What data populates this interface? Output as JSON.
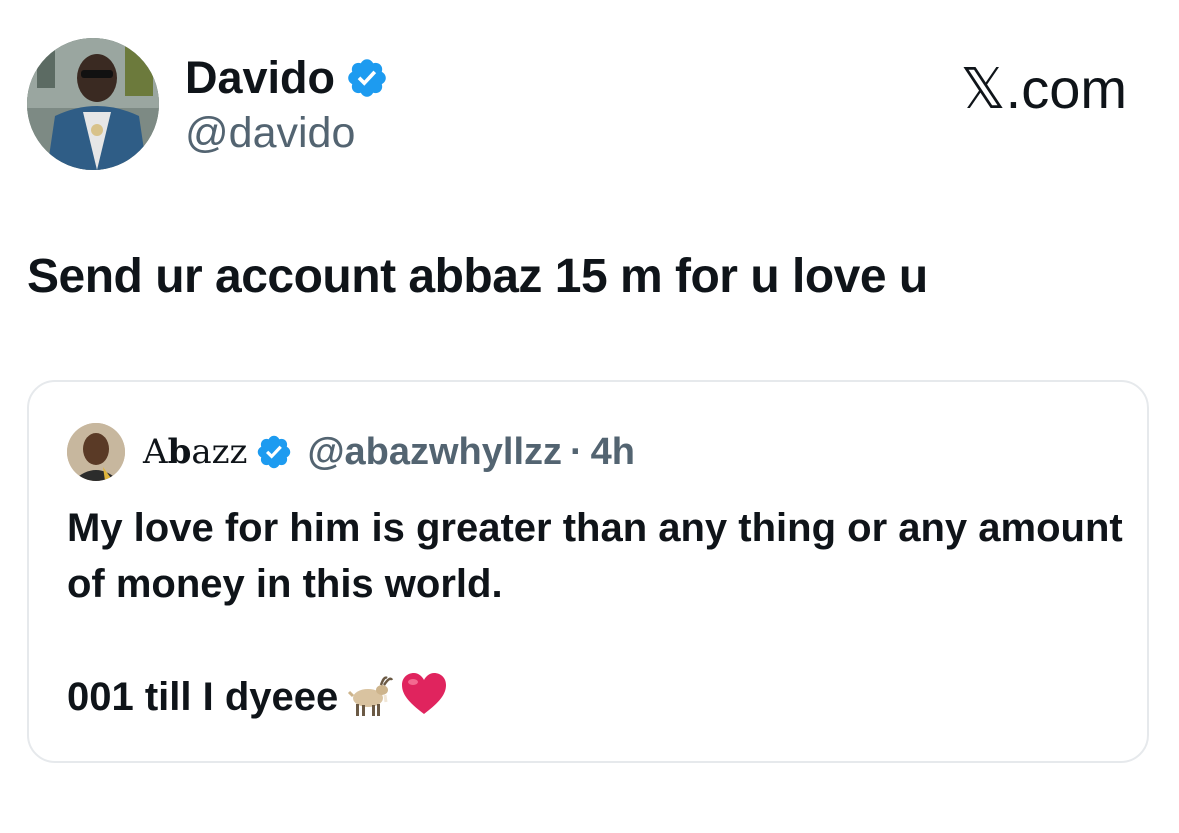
{
  "tweet": {
    "author_name": "Davido",
    "author_handle": "@davido",
    "site_label": "𝕏.com",
    "text": "Send ur account abbaz 15 m for u love u"
  },
  "quote": {
    "name_prefix": "A",
    "name_bold": "b",
    "name_suffix": "azz",
    "handle": "@abazwhyllzz",
    "separator": "·",
    "time": "4h",
    "line1": "My love for him is greater than any thing or any amount of money in this world.",
    "line2": "001 till I dyeee"
  },
  "icons": {
    "verified": "verified-badge-icon",
    "goat": "goat-emoji-icon",
    "heart": "red-heart-emoji-icon"
  },
  "colors": {
    "verified_blue": "#1d9bf0",
    "heart_red": "#e0245e",
    "muted_text": "#536471"
  }
}
